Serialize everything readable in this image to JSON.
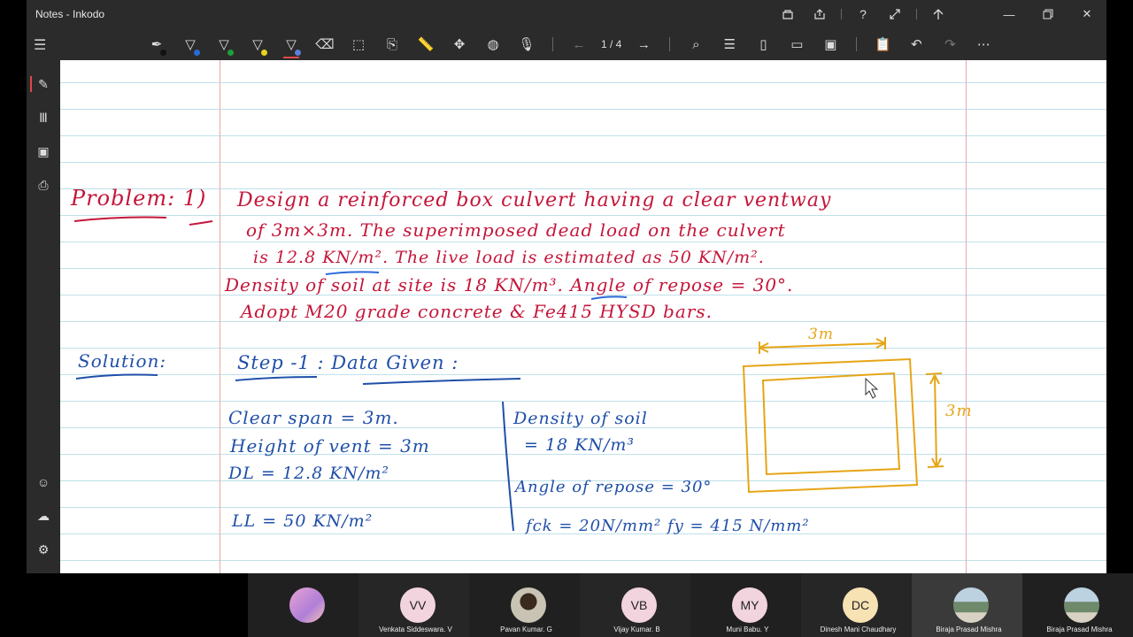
{
  "app": {
    "title": "Notes - Inkodo"
  },
  "titlebar_icons": [
    "store-icon",
    "share-icon",
    "help-icon",
    "fullscreen-icon",
    "arrow-up-icon"
  ],
  "window_controls": [
    "minimize-icon",
    "restore-icon",
    "close-icon"
  ],
  "toolbar": {
    "pens": [
      {
        "name": "pen-black",
        "color": "#111111"
      },
      {
        "name": "pen-blue",
        "color": "#2a6bd8"
      },
      {
        "name": "pen-green",
        "color": "#1e9e3a"
      },
      {
        "name": "pen-yellow",
        "color": "#e8d31c"
      },
      {
        "name": "pen-blue-2",
        "color": "#5a7fd6"
      }
    ],
    "page_indicator": "1 / 4"
  },
  "notes": {
    "problem_label": "Problem: 1)",
    "problem_lines": [
      "Design a reinforced box culvert having a clear ventway",
      "of 3m×3m. The superimposed dead load on the culvert",
      "is 12.8 KN/m². The live load is estimated as 50 KN/m².",
      "Density of soil at site is 18 KN/m³. Angle of repose = 30°.",
      "Adopt M20 grade concrete & Fe415 HYSD bars."
    ],
    "solution_label": "Solution:",
    "step_label": "Step -1 : Data Given :",
    "given_left": [
      "Clear span = 3m.",
      "Height of vent = 3m",
      "DL = 12.8 KN/m²",
      "LL = 50 KN/m²"
    ],
    "given_right": [
      "Density of soil",
      "= 18 KN/m³",
      "Angle of repose = 30°",
      "fck = 20N/mm²  fy = 415 N/mm²"
    ],
    "sketch_width": "3m",
    "sketch_height": "3m"
  },
  "participants": [
    {
      "initials": "",
      "name": "",
      "color": "#d9a0d8"
    },
    {
      "initials": "VV",
      "name": "Venkata Siddeswara. V",
      "color": "#f2d4de"
    },
    {
      "initials": "",
      "name": "Pavan Kumar. G",
      "color": "#8a7a5a"
    },
    {
      "initials": "VB",
      "name": "Vijay Kumar. B",
      "color": "#f2d4de"
    },
    {
      "initials": "MY",
      "name": "Muni Babu. Y",
      "color": "#f2d4de"
    },
    {
      "initials": "DC",
      "name": "Dinesh Mani Chaudhary",
      "color": "#f7e2b4"
    },
    {
      "initials": "",
      "name": "Biraja Prasad Mishra",
      "color": "#9fb8c8"
    },
    {
      "initials": "",
      "name": "Biraja Prasad Mishra",
      "color": "#9fb8c8"
    }
  ]
}
